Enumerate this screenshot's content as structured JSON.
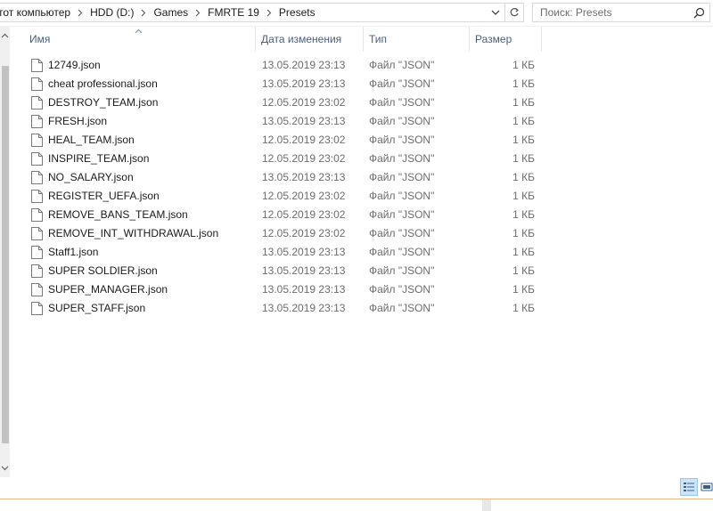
{
  "breadcrumb": {
    "items": [
      "тот компьютер",
      "HDD (D:)",
      "Games",
      "FMRTE 19",
      "Presets"
    ]
  },
  "search": {
    "placeholder": "Поиск: Presets"
  },
  "columns": {
    "name": "Имя",
    "date": "Дата изменения",
    "type": "Тип",
    "size": "Размер"
  },
  "files": [
    {
      "name": "12749.json",
      "date": "13.05.2019 23:13",
      "type": "Файл \"JSON\"",
      "size": "1 КБ"
    },
    {
      "name": "cheat professional.json",
      "date": "13.05.2019 23:13",
      "type": "Файл \"JSON\"",
      "size": "1 КБ"
    },
    {
      "name": "DESTROY_TEAM.json",
      "date": "12.05.2019 23:02",
      "type": "Файл \"JSON\"",
      "size": "1 КБ"
    },
    {
      "name": "FRESH.json",
      "date": "13.05.2019 23:13",
      "type": "Файл \"JSON\"",
      "size": "1 КБ"
    },
    {
      "name": "HEAL_TEAM.json",
      "date": "12.05.2019 23:02",
      "type": "Файл \"JSON\"",
      "size": "1 КБ"
    },
    {
      "name": "INSPIRE_TEAM.json",
      "date": "12.05.2019 23:02",
      "type": "Файл \"JSON\"",
      "size": "1 КБ"
    },
    {
      "name": "NO_SALARY.json",
      "date": "13.05.2019 23:13",
      "type": "Файл \"JSON\"",
      "size": "1 КБ"
    },
    {
      "name": "REGISTER_UEFA.json",
      "date": "12.05.2019 23:02",
      "type": "Файл \"JSON\"",
      "size": "1 КБ"
    },
    {
      "name": "REMOVE_BANS_TEAM.json",
      "date": "12.05.2019 23:02",
      "type": "Файл \"JSON\"",
      "size": "1 КБ"
    },
    {
      "name": "REMOVE_INT_WITHDRAWAL.json",
      "date": "12.05.2019 23:02",
      "type": "Файл \"JSON\"",
      "size": "1 КБ"
    },
    {
      "name": "Staff1.json",
      "date": "13.05.2019 23:13",
      "type": "Файл \"JSON\"",
      "size": "1 КБ"
    },
    {
      "name": "SUPER SOLDIER.json",
      "date": "13.05.2019 23:13",
      "type": "Файл \"JSON\"",
      "size": "1 КБ"
    },
    {
      "name": "SUPER_MANAGER.json",
      "date": "13.05.2019 23:13",
      "type": "Файл \"JSON\"",
      "size": "1 КБ"
    },
    {
      "name": "SUPER_STAFF.json",
      "date": "13.05.2019 23:13",
      "type": "Файл \"JSON\"",
      "size": "1 КБ"
    }
  ],
  "icons": {
    "file": "file-icon",
    "breadcrumb_separator": "chevron-right-icon",
    "address_dropdown": "chevron-down-icon",
    "refresh": "refresh-icon",
    "search": "search-icon",
    "sort": "sort-up-icon",
    "scroll_up": "scroll-up-icon",
    "scroll_down": "scroll-down-icon",
    "details_view": "details-view-icon",
    "tiles_view": "tiles-view-icon"
  },
  "colors": {
    "header_text": "#4c607a",
    "secondary_text": "#6d6d6d",
    "selected_view": "#cce4f7",
    "selected_view_border": "#99c9ef"
  }
}
